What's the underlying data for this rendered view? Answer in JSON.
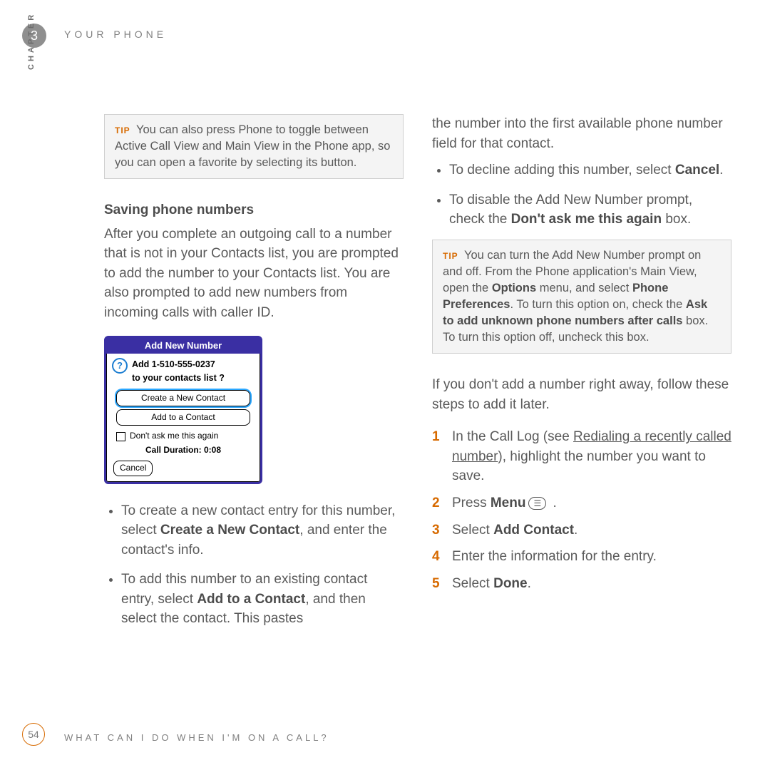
{
  "header": {
    "chapter_number": "3",
    "chapter_title": "YOUR PHONE",
    "chapter_label": "CHAPTER"
  },
  "footer": {
    "page_number": "54",
    "text": "WHAT CAN I DO WHEN I'M ON A CALL?"
  },
  "col1": {
    "tip_label": "TIP",
    "tip1": "You can also press Phone to toggle between Active Call View and Main View in the Phone app, so you can open a favorite by selecting its button.",
    "sect_title": "Saving phone numbers",
    "para1": "After you complete an outgoing call to a number that is not in your Contacts list, you are prompted to add the number to your Contacts list. You are also prompted to add new numbers from incoming calls with caller ID.",
    "bullets": {
      "b1_pre": "To create a new contact entry for this number, select ",
      "b1_bold": "Create a New Contact",
      "b1_post": ", and enter the contact's info.",
      "b2_pre": "To add this number to an existing contact entry, select ",
      "b2_bold": "Add to a Contact",
      "b2_post": ", and then select the contact. This pastes"
    }
  },
  "dialog": {
    "title": "Add New Number",
    "question_line1": "Add 1-510-555-0237",
    "question_line2": "to your contacts list ?",
    "btn_create": "Create a New Contact",
    "btn_add": "Add to a Contact",
    "checkbox": "Don't ask me this again",
    "duration": "Call Duration: 0:08",
    "btn_cancel": "Cancel"
  },
  "col2": {
    "cont_para": "the number into the first available phone number field for that contact.",
    "bullets": {
      "b1_pre": "To decline adding this number, select ",
      "b1_bold": "Cancel",
      "b1_post": ".",
      "b2_pre": "To disable the Add New Number prompt, check the ",
      "b2_bold": "Don't ask me this again",
      "b2_post": " box."
    },
    "tip_label": "TIP",
    "tip2_a": "You can turn the Add New Number prompt on and off. From the Phone application's Main View, open the ",
    "tip2_b1": "Options",
    "tip2_c": " menu, and select ",
    "tip2_b2": "Phone Preferences",
    "tip2_d": ". To turn this option on, check the ",
    "tip2_b3": "Ask to add unknown phone numbers after calls",
    "tip2_e": " box. To turn this option off, uncheck this box.",
    "para2": "If you don't add a number right away, follow these steps to add it later.",
    "steps": {
      "s1_pre": "In the Call Log (see ",
      "s1_link": "Redialing a recently called number",
      "s1_post": "), highlight the number you want to save.",
      "s2_pre": "Press ",
      "s2_bold": "Menu",
      "s2_post": " .",
      "s3_pre": "Select ",
      "s3_bold": "Add Contact",
      "s3_post": ".",
      "s4": "Enter the information for the entry.",
      "s5_pre": "Select ",
      "s5_bold": "Done",
      "s5_post": "."
    },
    "step_nums": {
      "n1": "1",
      "n2": "2",
      "n3": "3",
      "n4": "4",
      "n5": "5"
    }
  }
}
